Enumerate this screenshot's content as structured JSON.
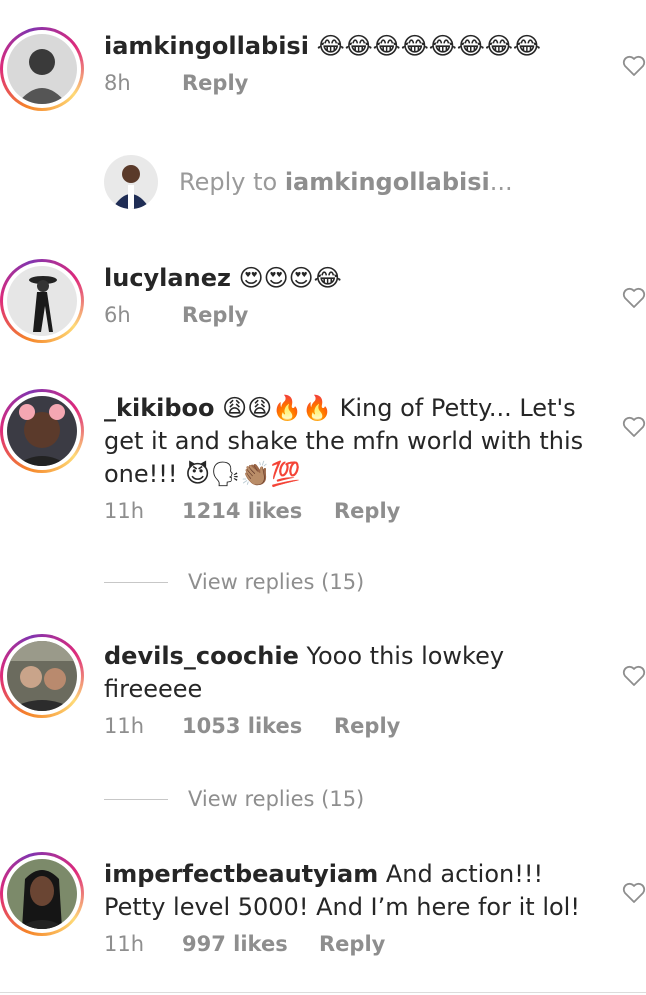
{
  "comments": [
    {
      "username": "iamkingollabisi",
      "text": "😂😂😂😂😂😂😂😂",
      "time": "8h",
      "likes": "",
      "reply_label": "Reply"
    },
    {
      "username": "lucylanez",
      "text": "😍😍😍😂",
      "time": "6h",
      "likes": "",
      "reply_label": "Reply"
    },
    {
      "username": "_kikiboo",
      "text": "😩😩🔥🔥 King of Petty... Let's get it and shake the mfn world with this one!!! 😈🗣👏🏽💯",
      "time": "11h",
      "likes": "1214 likes",
      "reply_label": "Reply",
      "view_replies": "View replies (15)"
    },
    {
      "username": "devils_coochie",
      "text": "Yooo this lowkey fireeeee",
      "time": "11h",
      "likes": "1053 likes",
      "reply_label": "Reply",
      "view_replies": "View replies (15)"
    },
    {
      "username": "imperfectbeautyiam",
      "text": "And action!!! Petty level 5000! And I’m here for it lol!",
      "time": "11h",
      "likes": "997 likes",
      "reply_label": "Reply"
    }
  ],
  "reply_input": {
    "prefix": "Reply to ",
    "target": "iamkingollabisi",
    "suffix": "..."
  },
  "colors": {
    "text": "#262626",
    "meta": "#8e8e8e",
    "ring_start": "#f58529",
    "ring_mid": "#dd2a7b",
    "ring_end": "#8134af"
  },
  "icons": {
    "like": "heart-outline-icon"
  }
}
